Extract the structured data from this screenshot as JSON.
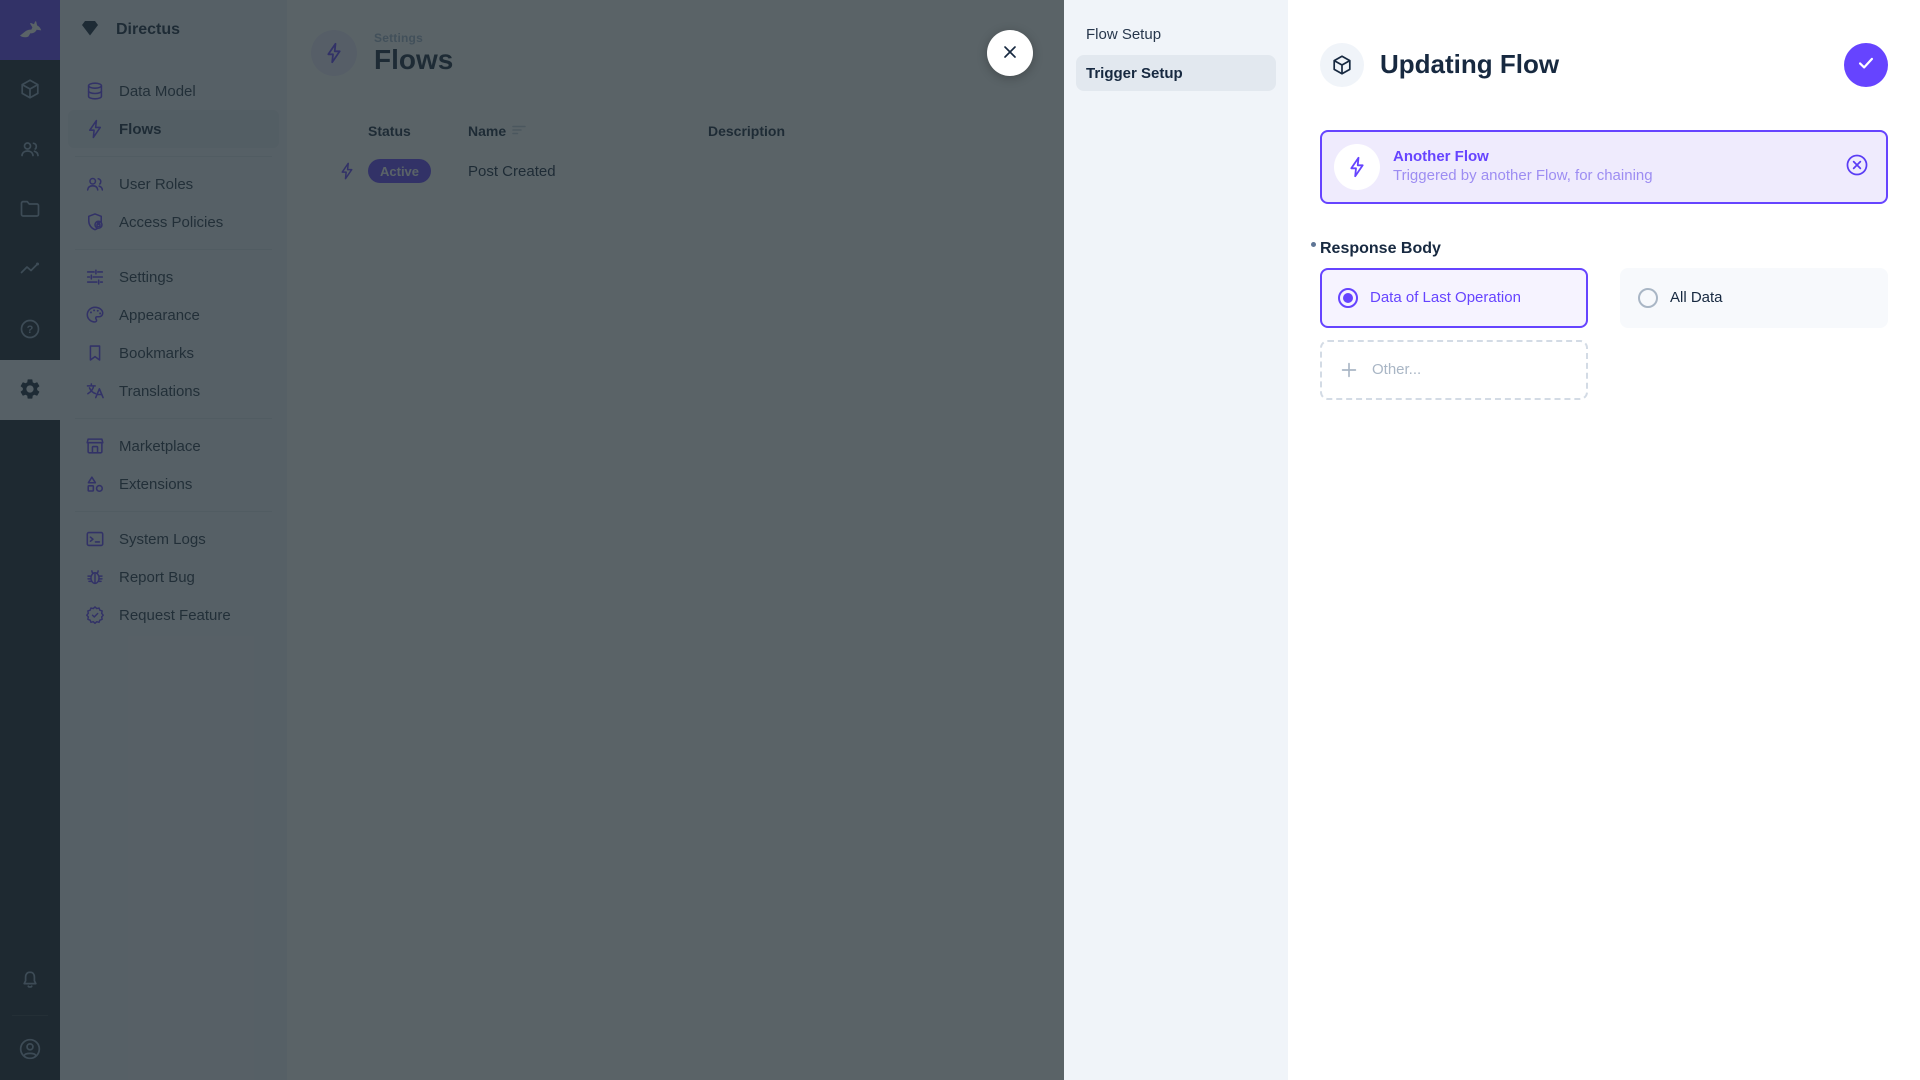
{
  "theme": {
    "primary": "#6644FF",
    "module-bar-bg": "#18222F",
    "sidebar-bg": "#F0F4F9",
    "text-dark": "#172940",
    "text-subdued": "#A2B5CD"
  },
  "module_bar": {
    "logo_icon": "directus-rabbit-icon",
    "modules": [
      {
        "name": "content",
        "icon": "box-icon"
      },
      {
        "name": "users",
        "icon": "people-icon"
      },
      {
        "name": "files",
        "icon": "folder-icon"
      },
      {
        "name": "insights",
        "icon": "insights-icon"
      },
      {
        "name": "documentation",
        "icon": "help-icon"
      },
      {
        "name": "settings",
        "icon": "gear-icon",
        "active": true
      }
    ],
    "notifications_icon": "bell-icon",
    "avatar_icon": "user-circle-icon"
  },
  "sidebar": {
    "project_name": "Directus",
    "project_icon": "diamond-icon",
    "items": [
      {
        "label": "Data Model",
        "icon": "database-icon",
        "active": false
      },
      {
        "label": "Flows",
        "icon": "bolt-icon",
        "active": true
      },
      {
        "label": "User Roles",
        "icon": "people-icon",
        "active": false
      },
      {
        "label": "Access Policies",
        "icon": "shield-lock-icon",
        "active": false
      },
      {
        "label": "Settings",
        "icon": "tune-icon",
        "active": false
      },
      {
        "label": "Appearance",
        "icon": "palette-icon",
        "active": false
      },
      {
        "label": "Bookmarks",
        "icon": "bookmark-icon",
        "active": false
      },
      {
        "label": "Translations",
        "icon": "translate-icon",
        "active": false
      },
      {
        "label": "Marketplace",
        "icon": "storefront-icon",
        "active": false
      },
      {
        "label": "Extensions",
        "icon": "shapes-icon",
        "active": false
      },
      {
        "label": "System Logs",
        "icon": "terminal-icon",
        "active": false
      },
      {
        "label": "Report Bug",
        "icon": "bug-icon",
        "active": false
      },
      {
        "label": "Request Feature",
        "icon": "badge-check-icon",
        "active": false
      }
    ]
  },
  "main": {
    "breadcrumb": "Settings",
    "title": "Flows",
    "title_icon": "bolt-icon",
    "table": {
      "columns": [
        "Status",
        "Name",
        "Description"
      ],
      "sort_icon": "sort-icon",
      "rows": [
        {
          "icon": "bolt-icon",
          "status": "Active",
          "name": "Post Created",
          "description": ""
        }
      ]
    }
  },
  "drawer": {
    "close_icon": "close-icon",
    "nav": [
      {
        "label": "Flow Setup",
        "active": false
      },
      {
        "label": "Trigger Setup",
        "active": true
      }
    ],
    "title": "Updating Flow",
    "header_icon": "box-icon",
    "confirm_icon": "check-icon",
    "trigger_card": {
      "icon": "bolt-icon",
      "title": "Another Flow",
      "subtitle": "Triggered by another Flow, for chaining",
      "clear_icon": "cancel-circle-icon"
    },
    "response_body_field": {
      "label": "Response Body",
      "required": true,
      "options": [
        {
          "label": "Data of Last Operation",
          "selected": true
        },
        {
          "label": "All Data",
          "selected": false
        }
      ],
      "other_label": "Other..."
    }
  }
}
